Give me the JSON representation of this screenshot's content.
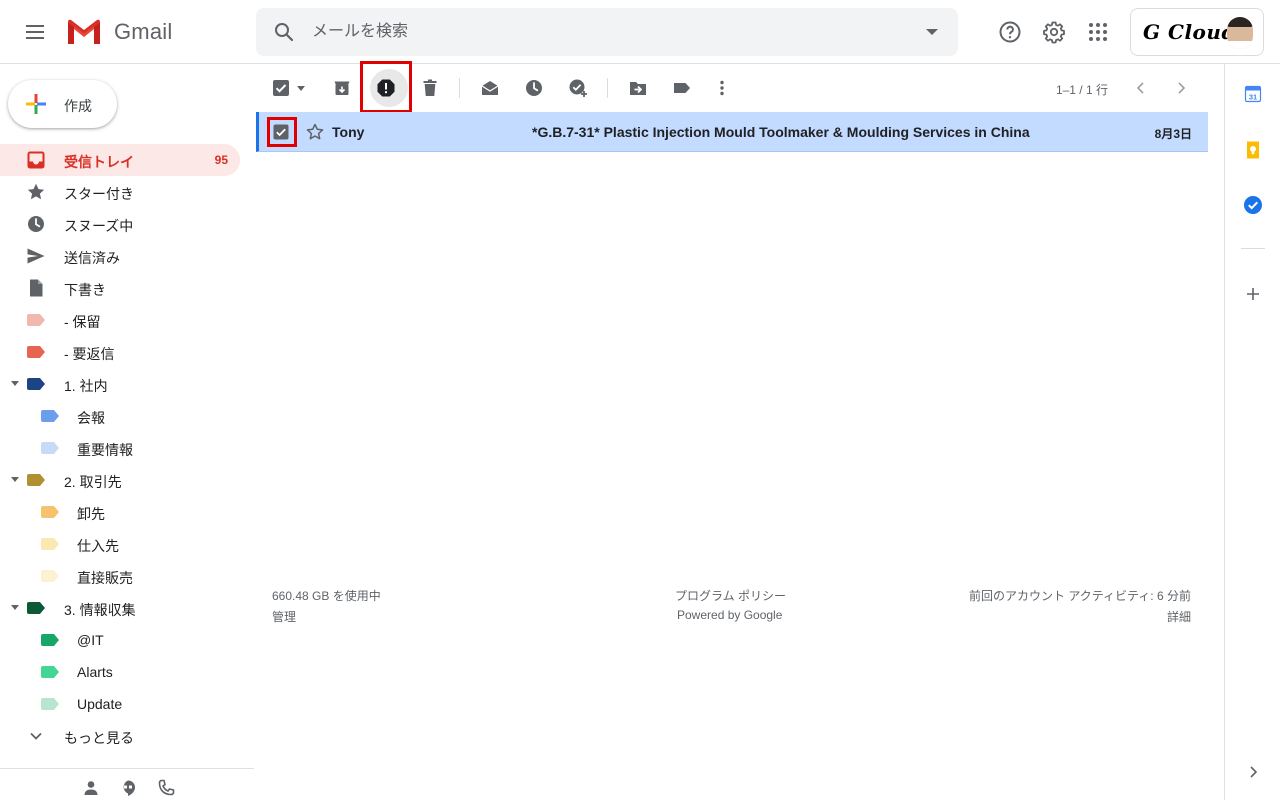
{
  "header": {
    "app_name": "Gmail",
    "search_placeholder": "メールを検索",
    "account_brand": "G Cloud"
  },
  "compose": {
    "label": "作成"
  },
  "sidebar": {
    "items": [
      {
        "label": "受信トレイ",
        "count": "95",
        "icon": "inbox-icon"
      },
      {
        "label": "スター付き",
        "icon": "star-icon"
      },
      {
        "label": "スヌーズ中",
        "icon": "clock-icon"
      },
      {
        "label": "送信済み",
        "icon": "send-icon"
      },
      {
        "label": "下書き",
        "icon": "draft-icon"
      },
      {
        "label": "- 保留",
        "icon": "label-icon",
        "color": "#f2b8ad"
      },
      {
        "label": "- 要返信",
        "icon": "label-icon",
        "color": "#e66550"
      },
      {
        "label": "1. 社内",
        "icon": "label-icon",
        "color": "#1c4587"
      },
      {
        "label": "会報",
        "icon": "label-icon",
        "color": "#6d9eeb"
      },
      {
        "label": "重要情報",
        "icon": "label-icon",
        "color": "#c9daf8"
      },
      {
        "label": "2. 取引先",
        "icon": "label-icon",
        "color": "#b3902f"
      },
      {
        "label": "卸先",
        "icon": "label-icon",
        "color": "#f6c26b"
      },
      {
        "label": "仕入先",
        "icon": "label-icon",
        "color": "#fce8b3"
      },
      {
        "label": "直接販売",
        "icon": "label-icon",
        "color": "#fef1d1"
      },
      {
        "label": "3. 情報収集",
        "icon": "label-icon",
        "color": "#0b5a36"
      },
      {
        "label": "@IT",
        "icon": "label-icon",
        "color": "#16a766"
      },
      {
        "label": "Alarts",
        "icon": "label-icon",
        "color": "#43d692"
      },
      {
        "label": "Update",
        "icon": "label-icon",
        "color": "#b9e4d0"
      },
      {
        "label": "もっと見る",
        "icon": "chevron-down-icon"
      }
    ]
  },
  "toolbar": {
    "pager_text": "1–1 / 1 行"
  },
  "email": {
    "sender": "Tony",
    "subject": "*G.B.7-31* Plastic Injection Mould Toolmaker & Moulding Services in China",
    "date": "8月3日"
  },
  "footer": {
    "storage": "660.48 GB を使用中",
    "manage": "管理",
    "policy": "プログラム ポリシー",
    "powered": "Powered by Google",
    "activity": "前回のアカウント アクティビティ: 6 分前",
    "details": "詳細"
  },
  "colors": {
    "highlight": "#e00000",
    "accent_red": "#d93025",
    "selected_row": "#c2dbff"
  }
}
